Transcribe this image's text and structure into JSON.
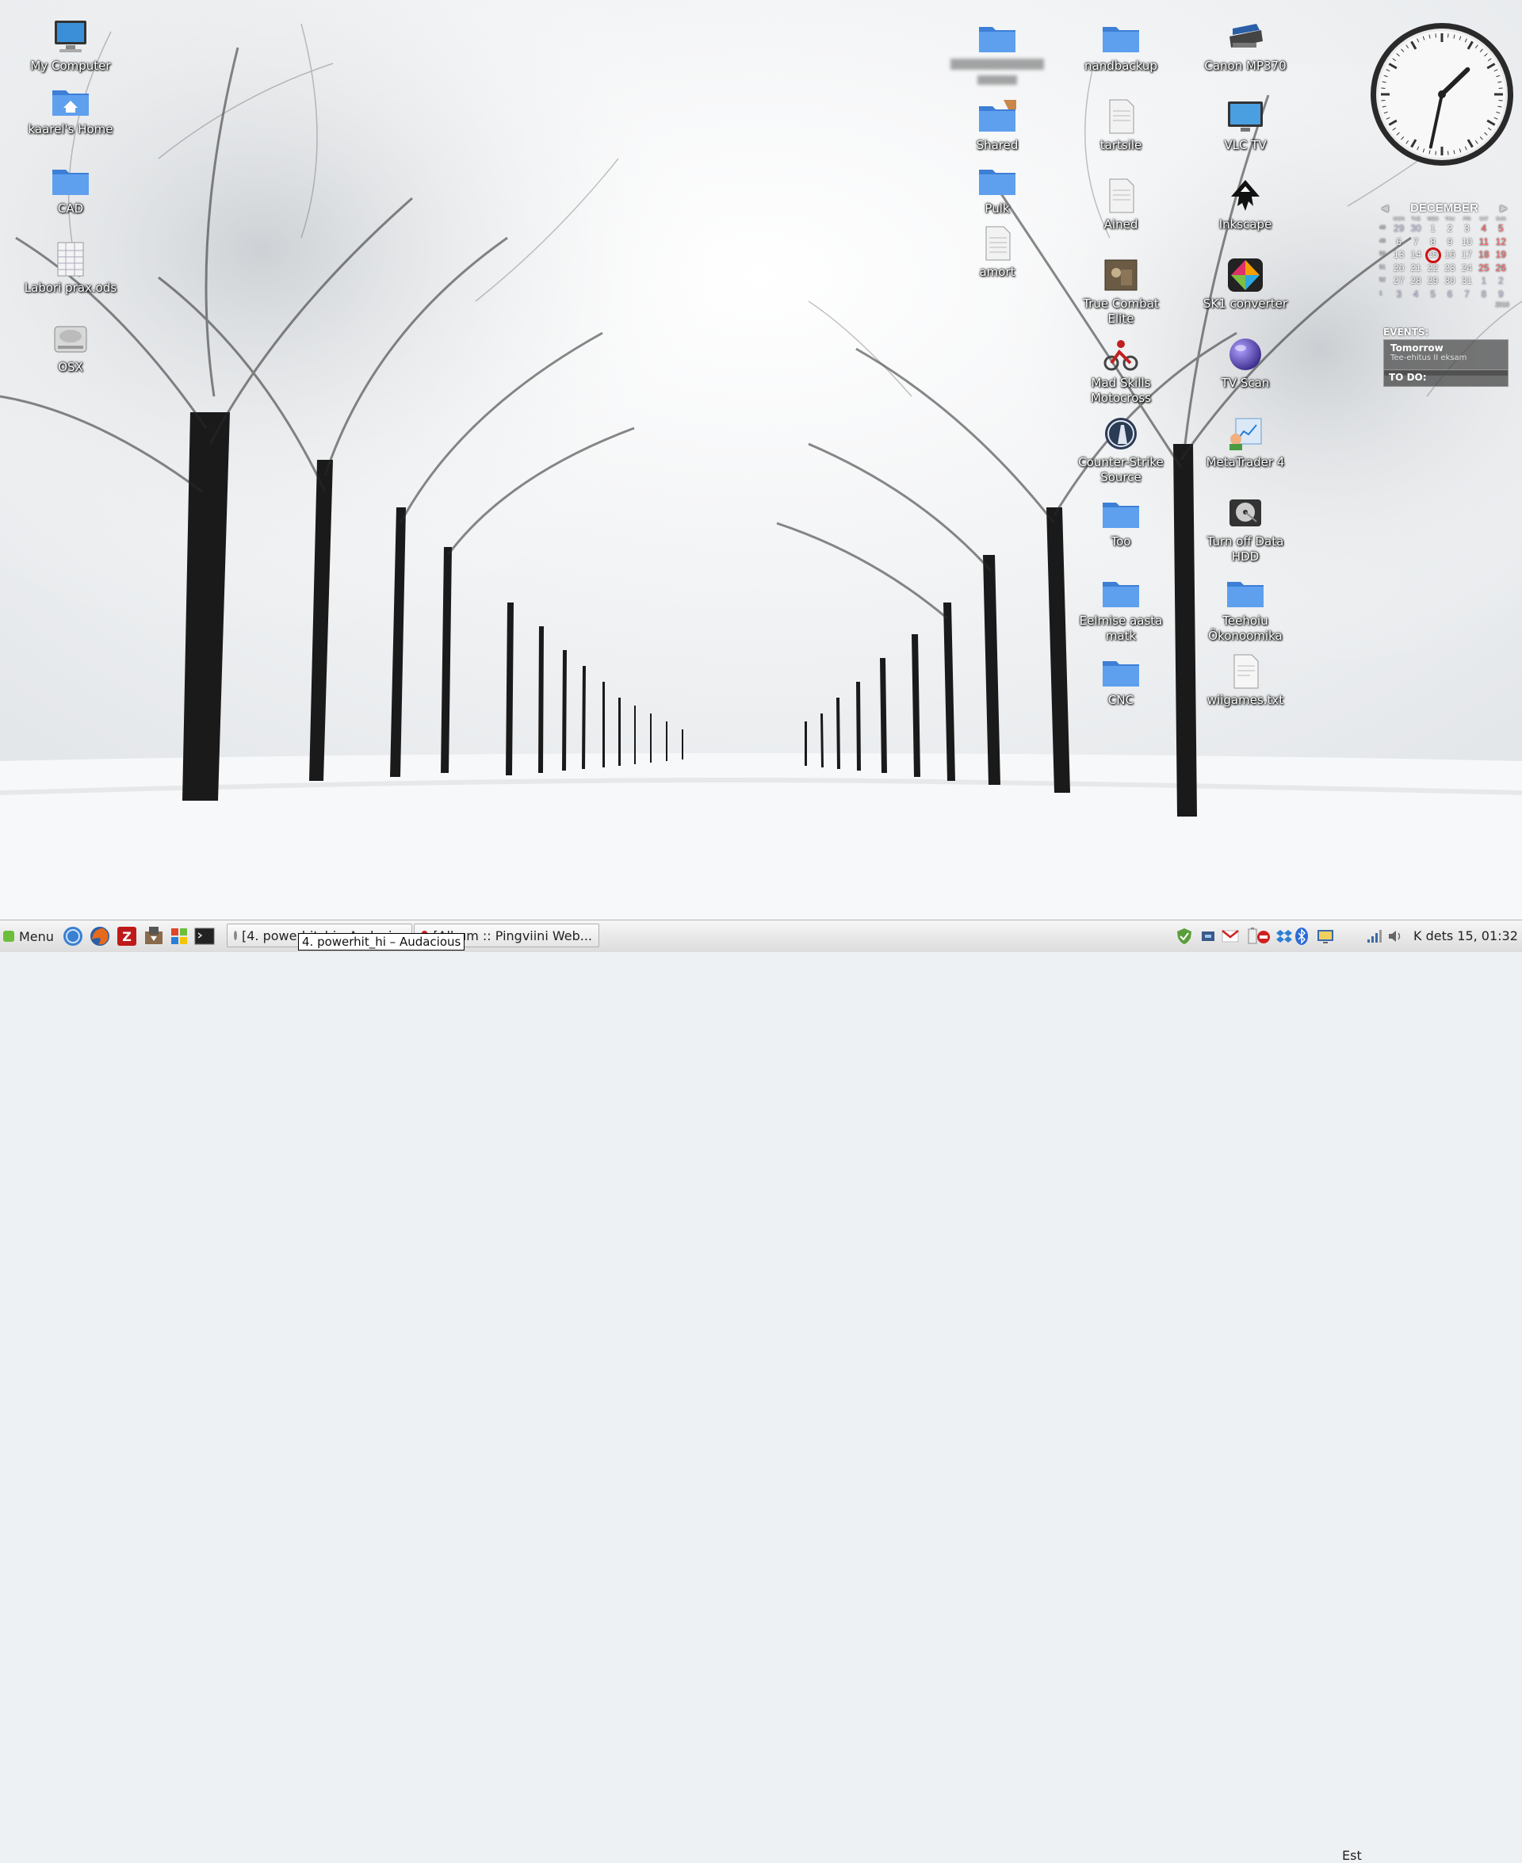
{
  "desktop": {
    "icons_left": [
      {
        "label": "My Computer",
        "icon": "computer-icon"
      },
      {
        "label": "kaarel's Home",
        "icon": "home-folder-icon"
      },
      {
        "label": "CAD",
        "icon": "folder-icon"
      },
      {
        "label": "Labori prax.ods",
        "icon": "spreadsheet-icon"
      },
      {
        "label": "OSX",
        "icon": "hard-drive-icon"
      }
    ],
    "icons_col1": [
      {
        "label": "",
        "icon": "folder-icon"
      },
      {
        "label": "Shared",
        "icon": "shared-folder-icon"
      },
      {
        "label": "Pulk",
        "icon": "folder-icon"
      },
      {
        "label": "amort",
        "icon": "document-icon"
      }
    ],
    "icons_col2": [
      {
        "label": "nandbackup",
        "icon": "folder-icon"
      },
      {
        "label": "tartsile",
        "icon": "document-icon"
      },
      {
        "label": "Ained",
        "icon": "document-icon"
      },
      {
        "label": "True Combat Elite",
        "icon": "game-icon"
      },
      {
        "label": "Mad Skills Motocross",
        "icon": "motocross-icon"
      },
      {
        "label": "Counter-Strike Source",
        "icon": "counter-strike-icon"
      },
      {
        "label": "Too",
        "icon": "folder-icon"
      },
      {
        "label": "Eelmise aasta matk",
        "icon": "folder-icon"
      },
      {
        "label": "CNC",
        "icon": "folder-icon"
      }
    ],
    "icons_col3": [
      {
        "label": "Canon MP370",
        "icon": "printer-icon"
      },
      {
        "label": "VLC TV",
        "icon": "tv-icon"
      },
      {
        "label": "Inkscape",
        "icon": "inkscape-icon"
      },
      {
        "label": "SK1 converter",
        "icon": "sk1-icon"
      },
      {
        "label": "TV Scan",
        "icon": "globe-icon"
      },
      {
        "label": "MetaTrader 4",
        "icon": "metatrader-icon"
      },
      {
        "label": "Turn off Data HDD",
        "icon": "hdd-icon"
      },
      {
        "label": "Teehoiu Ökonoomika",
        "icon": "folder-icon"
      },
      {
        "label": "wiigames.txt",
        "icon": "text-file-icon"
      }
    ]
  },
  "calendar": {
    "month": "DECEMBER",
    "weekdays": [
      "MON",
      "TUE",
      "WED",
      "THU",
      "FRI",
      "SAT",
      "SUN"
    ],
    "weeks": [
      {
        "wk": "48",
        "days": [
          "29",
          "30",
          "1",
          "2",
          "3",
          "4",
          "5"
        ]
      },
      {
        "wk": "49",
        "days": [
          "6",
          "7",
          "8",
          "9",
          "10",
          "11",
          "12"
        ]
      },
      {
        "wk": "50",
        "days": [
          "13",
          "14",
          "15",
          "16",
          "17",
          "18",
          "19"
        ]
      },
      {
        "wk": "51",
        "days": [
          "20",
          "21",
          "22",
          "23",
          "24",
          "25",
          "26"
        ]
      },
      {
        "wk": "52",
        "days": [
          "27",
          "28",
          "29",
          "30",
          "31",
          "1",
          "2"
        ]
      },
      {
        "wk": "1",
        "days": [
          "3",
          "4",
          "5",
          "6",
          "7",
          "8",
          "9"
        ]
      }
    ],
    "today": "15",
    "year": "2010",
    "events_header": "EVENTS:",
    "event_day": "Tomorrow",
    "event_text": "Tee-ehitus II eksam",
    "todo_header": "TO DO:"
  },
  "clock": {
    "hour": 1,
    "minute": 32
  },
  "taskbar": {
    "menu_label": "Menu",
    "launchers": [
      "internet-icon",
      "firefox-icon",
      "filezilla-icon",
      "installer-icon",
      "windows-icon",
      "terminal-icon"
    ],
    "tasks": [
      {
        "label": "[4. powerhit_hi - Audacious]",
        "icon": "audacious-icon"
      },
      {
        "label": "[Album :: Pingviini Web...",
        "icon": "opera-icon"
      }
    ],
    "tooltip": "4. powerhit_hi – Audacious",
    "tray": [
      "shield-check-icon",
      "network-icon",
      "gmail-icon",
      "battery-icon",
      "blocked-icon",
      "dropbox-icon",
      "bluetooth-icon",
      "display-icon"
    ],
    "keyboard_layout": "Est",
    "datetime": "K dets  15, 01:32"
  },
  "colors": {
    "folder_blue": "#4a8fe0",
    "today_ring": "#d01010",
    "taskbar_bg": "#e8e8e8"
  }
}
